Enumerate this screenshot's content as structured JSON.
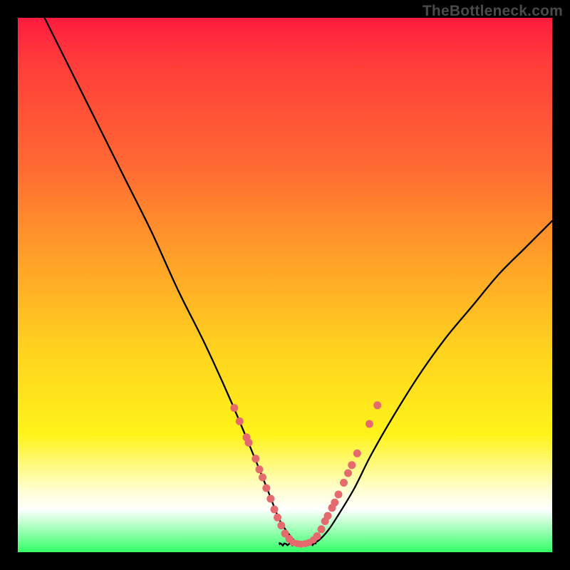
{
  "watermark": "TheBottleneck.com",
  "colors": {
    "frame_bg": "#000000",
    "curve": "#000000",
    "dots": "#e46a6e",
    "gradient_stops": [
      "#ff1c3f",
      "#ff3b3b",
      "#ff6a33",
      "#ffa028",
      "#ffd21f",
      "#fff31a",
      "#fffecb",
      "#ffffff",
      "#33ff66"
    ]
  },
  "chart_data": {
    "type": "line",
    "title": "",
    "xlabel": "",
    "ylabel": "",
    "xlim": [
      0,
      100
    ],
    "ylim": [
      0,
      100
    ],
    "series": [
      {
        "name": "curve",
        "x": [
          5,
          10,
          15,
          20,
          25,
          30,
          35,
          40,
          45,
          47,
          49,
          51,
          52,
          53,
          54,
          56,
          58,
          60,
          63,
          66,
          70,
          75,
          80,
          85,
          90,
          95,
          100
        ],
        "y": [
          100,
          90,
          80,
          70,
          60,
          49,
          39,
          28,
          16,
          11,
          6,
          3,
          2,
          1.5,
          1.5,
          2,
          4,
          7,
          12,
          18,
          25,
          33,
          40,
          46,
          52,
          57,
          62
        ]
      }
    ],
    "valley_floor": {
      "x_start": 49,
      "x_end": 56,
      "y": 1.5
    },
    "scatter_left": [
      {
        "x": 40.5,
        "y": 27
      },
      {
        "x": 41.5,
        "y": 24.5
      },
      {
        "x": 42.8,
        "y": 21.5
      },
      {
        "x": 43.2,
        "y": 20.5
      },
      {
        "x": 44.5,
        "y": 17.5
      },
      {
        "x": 45.2,
        "y": 15.5
      },
      {
        "x": 45.8,
        "y": 14
      },
      {
        "x": 46.5,
        "y": 12
      },
      {
        "x": 47.3,
        "y": 10
      },
      {
        "x": 48.0,
        "y": 8
      },
      {
        "x": 48.6,
        "y": 6.5
      },
      {
        "x": 49.3,
        "y": 5
      },
      {
        "x": 50.0,
        "y": 3.5
      },
      {
        "x": 50.8,
        "y": 2.5
      }
    ],
    "scatter_floor": [
      {
        "x": 51.5,
        "y": 1.8
      },
      {
        "x": 52.3,
        "y": 1.6
      },
      {
        "x": 53.0,
        "y": 1.5
      },
      {
        "x": 53.8,
        "y": 1.6
      },
      {
        "x": 54.5,
        "y": 1.8
      },
      {
        "x": 55.3,
        "y": 2.3
      }
    ],
    "scatter_right": [
      {
        "x": 56.0,
        "y": 3
      },
      {
        "x": 56.8,
        "y": 4.3
      },
      {
        "x": 57.5,
        "y": 5.8
      },
      {
        "x": 58.0,
        "y": 6.8
      },
      {
        "x": 58.8,
        "y": 8.3
      },
      {
        "x": 59.3,
        "y": 9.3
      },
      {
        "x": 60.0,
        "y": 10.8
      },
      {
        "x": 61.0,
        "y": 13
      },
      {
        "x": 61.8,
        "y": 14.8
      },
      {
        "x": 62.5,
        "y": 16.3
      },
      {
        "x": 63.5,
        "y": 18.5
      },
      {
        "x": 65.8,
        "y": 24
      },
      {
        "x": 67.3,
        "y": 27.5
      }
    ]
  }
}
